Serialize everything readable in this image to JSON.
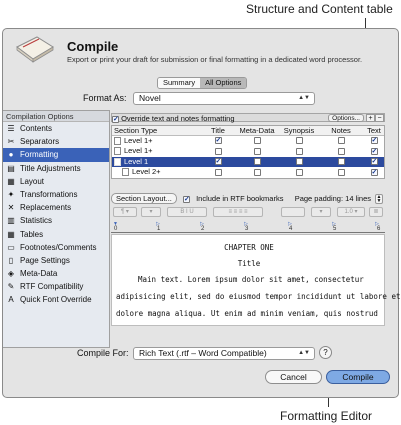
{
  "callouts": {
    "structure_and_content_table": "Structure and Content table",
    "formatting_editor": "Formatting Editor"
  },
  "dialog": {
    "title": "Compile",
    "subtitle": "Export or print your draft for submission or final formatting in a dedicated word processor.",
    "mode_tabs": [
      {
        "label": "Summary",
        "active": false
      },
      {
        "label": "All Options",
        "active": true
      }
    ],
    "format_as": {
      "label": "Format As:",
      "value": "Novel"
    }
  },
  "compilation_options": {
    "header": "Compilation Options",
    "items": [
      {
        "label": "Contents",
        "icon": "contents-icon",
        "glyph": "☰",
        "selected": false
      },
      {
        "label": "Separators",
        "icon": "separators-icon",
        "glyph": "✂",
        "selected": false
      },
      {
        "label": "Formatting",
        "icon": "formatting-icon",
        "glyph": "●",
        "selected": true
      },
      {
        "label": "Title Adjustments",
        "icon": "title-adjustments-icon",
        "glyph": "▤",
        "selected": false
      },
      {
        "label": "Layout",
        "icon": "layout-icon",
        "glyph": "▦",
        "selected": false
      },
      {
        "label": "Transformations",
        "icon": "transformations-icon",
        "glyph": "✦",
        "selected": false
      },
      {
        "label": "Replacements",
        "icon": "replacements-icon",
        "glyph": "✕",
        "selected": false
      },
      {
        "label": "Statistics",
        "icon": "statistics-icon",
        "glyph": "▥",
        "selected": false
      },
      {
        "label": "Tables",
        "icon": "tables-icon",
        "glyph": "▦",
        "selected": false
      },
      {
        "label": "Footnotes/Comments",
        "icon": "footnotes-icon",
        "glyph": "▭",
        "selected": false
      },
      {
        "label": "Page Settings",
        "icon": "page-settings-icon",
        "glyph": "▯",
        "selected": false
      },
      {
        "label": "Meta-Data",
        "icon": "meta-data-icon",
        "glyph": "◈",
        "selected": false
      },
      {
        "label": "RTF Compatibility",
        "icon": "rtf-compatibility-icon",
        "glyph": "✎",
        "selected": false
      },
      {
        "label": "Quick Font Override",
        "icon": "quick-font-override-icon",
        "glyph": "A",
        "selected": false
      }
    ]
  },
  "formatting": {
    "override_label": "Override text and notes formatting",
    "override_checked": true,
    "options_button": "Options...",
    "table": {
      "columns": [
        "Section Type",
        "Title",
        "Meta-Data",
        "Synopsis",
        "Notes",
        "Text"
      ],
      "rows": [
        {
          "label": "Level  1+",
          "indent": 0,
          "selected": false,
          "checks": [
            true,
            false,
            false,
            false,
            true
          ]
        },
        {
          "label": "Level  1+",
          "indent": 0,
          "selected": false,
          "checks": [
            false,
            false,
            false,
            false,
            true
          ]
        },
        {
          "label": "Level  1",
          "indent": 0,
          "selected": true,
          "checks": [
            true,
            false,
            false,
            false,
            true
          ]
        },
        {
          "label": "Level  2+",
          "indent": 1,
          "selected": false,
          "checks": [
            false,
            false,
            false,
            false,
            true
          ]
        }
      ]
    },
    "section_layout_button": "Section Layout...",
    "rtf_bookmarks_label": "Include in RTF bookmarks",
    "rtf_bookmarks_checked": true,
    "page_padding_label": "Page padding: 14 lines",
    "ruler_numbers": [
      "0",
      "1",
      "2",
      "3",
      "4",
      "5",
      "6"
    ],
    "editor": {
      "heading": "CHAPTER ONE",
      "title": "Title",
      "body_lines": [
        "Main text. Lorem ipsum dolor sit amet, consectetur",
        "adipisicing elit, sed do eiusmod tempor incididunt ut labore et",
        "dolore magna aliqua. Ut enim ad minim veniam, quis nostrud"
      ]
    }
  },
  "compile_for": {
    "label": "Compile For:",
    "value": "Rich Text (.rtf – Word Compatible)"
  },
  "buttons": {
    "help": "?",
    "cancel": "Cancel",
    "compile": "Compile"
  }
}
